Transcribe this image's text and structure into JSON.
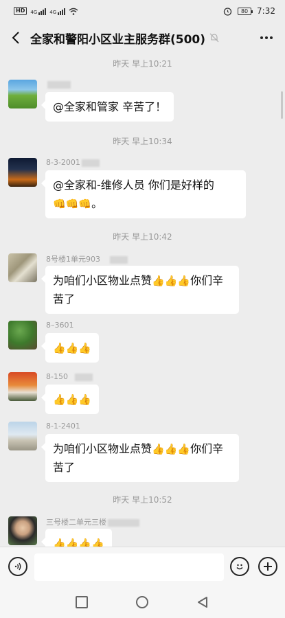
{
  "status_bar": {
    "network_badge": "HD",
    "signal_label_1": "4G",
    "signal_label_2": "4G",
    "battery_level": "80",
    "time": "7:32"
  },
  "header": {
    "title": "全家和警阳小区业主服务群(500)",
    "icons": {
      "back": "chevron-left-icon",
      "mute": "bell-muted-icon",
      "more": "more-dots-icon"
    }
  },
  "messages": [
    {
      "type": "time",
      "text": "昨天 早上10:21"
    },
    {
      "type": "msg",
      "sender": "",
      "text": "@全家和管家  辛苦了！",
      "avatar": "field-landscape"
    },
    {
      "type": "time",
      "text": "昨天 早上10:34"
    },
    {
      "type": "msg",
      "sender": "8-3-2001",
      "text": "@全家和-维修人员  你们是好样的",
      "emojis": [
        "👊",
        "👊",
        "👊"
      ],
      "suffix": "。",
      "avatar": "sunset-silhouette"
    },
    {
      "type": "time",
      "text": "昨天 早上10:42"
    },
    {
      "type": "msg",
      "sender": "8号楼1单元903",
      "text": "为咱们小区物业点赞",
      "emojis": [
        "👍",
        "👍",
        "👍"
      ],
      "suffix": "你们辛苦了",
      "avatar": "room-interior"
    },
    {
      "type": "msg",
      "sender": "8–3601",
      "text": "",
      "emojis": [
        "👍",
        "👍",
        "👍"
      ],
      "avatar": "green-trees"
    },
    {
      "type": "msg",
      "sender": "8-150",
      "text": "",
      "emojis": [
        "👍",
        "👍",
        "👍"
      ],
      "avatar": "autumn-tree"
    },
    {
      "type": "msg",
      "sender": "8-1-2401",
      "text": "为咱们小区物业点赞",
      "emojis": [
        "👍",
        "👍",
        "👍"
      ],
      "suffix": "你们辛苦了",
      "avatar": "beach-figure"
    },
    {
      "type": "time",
      "text": "昨天 早上10:52"
    },
    {
      "type": "msg",
      "sender": "三号楼二单元三楼",
      "text": "",
      "emojis": [
        "👍",
        "👍",
        "👍",
        "👍"
      ],
      "avatar": "person-photo"
    }
  ],
  "input_bar": {
    "placeholder": "",
    "icons": {
      "voice": "voice-icon",
      "emoji": "emoji-icon",
      "plus": "plus-icon"
    }
  },
  "nav_bar": {
    "icons": [
      "recent-apps-icon",
      "home-icon",
      "back-triangle-icon"
    ]
  }
}
